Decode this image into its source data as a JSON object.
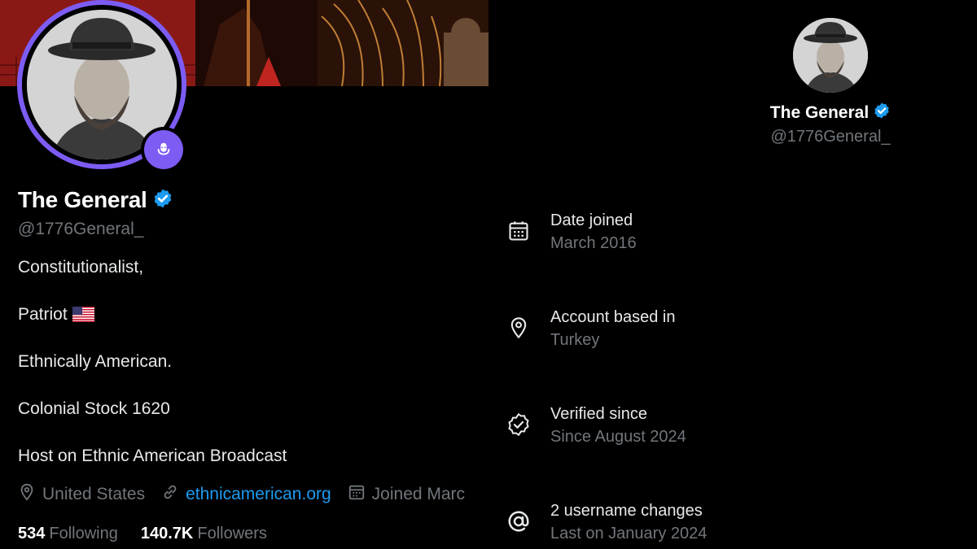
{
  "profile": {
    "display_name": "The General",
    "handle": "@1776General_",
    "bio": [
      "Constitutionalist,",
      "Patriot",
      "Ethnically American.",
      "Colonial Stock 1620",
      "Host on Ethnic American Broadcast"
    ],
    "location": "United States",
    "website": "ethnicamerican.org",
    "joined": "Joined Marc",
    "following_count": "534",
    "following_label": "Following",
    "followers_count": "140.7K",
    "followers_label": "Followers"
  },
  "about": {
    "display_name": "The General",
    "handle": "@1776General_",
    "items": [
      {
        "title": "Date joined",
        "value": "March 2016",
        "icon": "calendar-icon"
      },
      {
        "title": "Account based in",
        "value": "Turkey",
        "icon": "location-pin-icon"
      },
      {
        "title": "Verified since",
        "value": "Since August 2024",
        "icon": "verified-check-icon"
      },
      {
        "title": "2 username changes",
        "value": "Last on January 2024",
        "icon": "at-sign-icon"
      }
    ]
  },
  "colors": {
    "background": "#000000",
    "accent_blue": "#1d9bf0",
    "verified_blue": "#1d9bf0",
    "avatar_ring": "#7d5cf4",
    "muted_text": "#71767b"
  }
}
